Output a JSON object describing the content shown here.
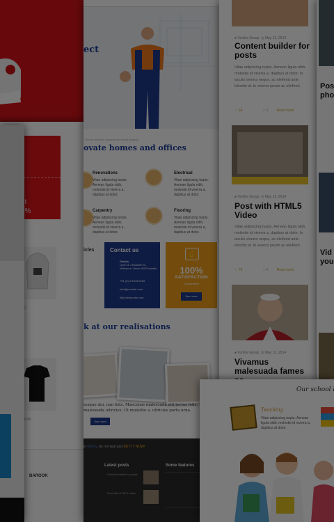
{
  "center": {
    "hero_heading": "ect",
    "realisations_intro": "We are proud to present our recent projects",
    "section_heading": "ovate homes and offices",
    "services": [
      {
        "title": "Renovations",
        "text": "Vitae adipiscing turpis. Aenean ligula nibh, molestie id viverra a, dapibus at dolor."
      },
      {
        "title": "Electrical",
        "text": "Vitae adipiscing turpis. Aenean ligula nibh, molestie id viverra a, dapibus at dolor."
      },
      {
        "title": "Carpentry",
        "text": "Vitae adipiscing turpis. Aenean ligula nibh, molestie id viverra a, dapibus at dolor."
      },
      {
        "title": "Flooring",
        "text": "Vitae adipiscing turpis. Aenean ligula nibh, molestie id viverra a, dapibus at dolor."
      }
    ],
    "articles_label": "icles",
    "contact": {
      "title": "Contact us",
      "address_label": "Details",
      "address": "Level 13, 2 Elizabeth St, Melbourne, Victoria 3000 Australia",
      "phone": "+61 (0) 3 8376 6284",
      "email": "info@yoursite.com",
      "web": "http://www.site.com"
    },
    "satisfaction": {
      "big": "100%",
      "word": "SATISFACTION",
      "sub": "Guaranteed",
      "button": "See more"
    },
    "work_heading": "k at our realisations",
    "work_text": "tesque dui, non felis. Maecenas malesuada elit lectus felis, malesuada ultricies. Ut molestie a, ultricies porta urna.",
    "work_button": "See more",
    "footer_cta_prefix": "in ",
    "footer_cta_brand": "Renov",
    "footer_cta_mid": ", do not wait and ",
    "footer_cta_action": "BUY IT NOW!",
    "latest_posts_title": "Latest posts",
    "some_features_title": "Some features",
    "latest_posts": [
      "Content builder for posts",
      "Post with HTML5 video"
    ]
  },
  "shop": {
    "product1_price": "2",
    "product2_name": "tote",
    "brand": "BAROOK",
    "promo_line1": "ut",
    "promo_line2": "0%"
  },
  "blog": {
    "posts": [
      {
        "author": "Vonfire Group",
        "date": "May 12, 2014",
        "title": "Content builder for posts",
        "excerpt": "Vitae adipiscing turpis. Aenean ligula nibh, molestie id viverra a, dapibus at dolor. In iaculis viverra neque, ac eleifend ante lobortis id. In viverra ipsum ac eleifend.",
        "likes": "54",
        "comments": "1",
        "more": "Read more"
      },
      {
        "author": "Vonfire Group",
        "date": "May 12, 2014",
        "title": "Post with HTML5 Video",
        "excerpt": "Vitae adipiscing turpis. Aenean ligula nibh, molestie id viverra a, dapibus at dolor. In iaculis viverra neque, ac eleifend ante lobortis id. In viverra ipsum ac eleifend.",
        "likes": "79",
        "comments": "4",
        "more": "Read more"
      },
      {
        "author": "Vonfire Group",
        "date": "May 12, 2014",
        "title": "Vivamus malesuada fames ac"
      }
    ]
  },
  "far_right": {
    "snippet1": "Pos pho",
    "snippet2": "Vid you"
  },
  "school": {
    "heading": "Our school is",
    "feature": "Teaching",
    "feature_text": "Vitae adipiscing turpis. Aenean ligula nibh, molestie id viverra a, dapibus at dolor."
  }
}
